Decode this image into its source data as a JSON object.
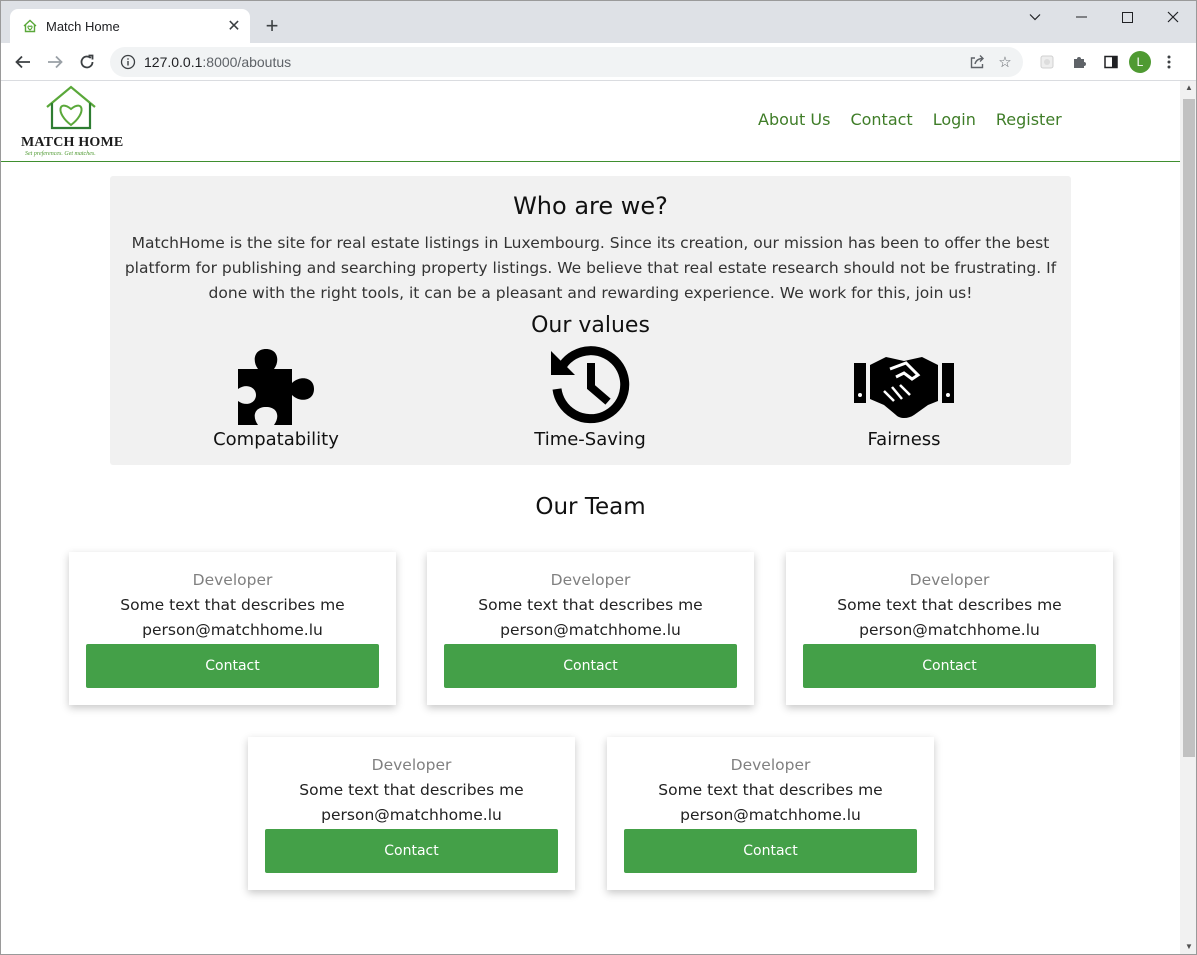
{
  "browser": {
    "tab_title": "Match Home",
    "url_host": "127.0.0.1",
    "url_rest": ":8000/aboutus",
    "profile_initial": "L"
  },
  "site": {
    "logo_text": "MATCH HOME",
    "logo_tagline": "Set preferences. Get matches.",
    "nav": [
      "About Us",
      "Contact",
      "Login",
      "Register"
    ],
    "brand_green": "#44a048"
  },
  "about": {
    "title": "Who are we?",
    "text": "MatchHome is the site for real estate listings in Luxembourg. Since its creation, our mission has been to offer the best platform for publishing and searching property listings. We believe that real estate research should not be frustrating. If done with the right tools, it can be a pleasant and rewarding experience. We work for this, join us!",
    "values_title": "Our values",
    "values": [
      {
        "label": "Compatability",
        "icon": "puzzle-icon"
      },
      {
        "label": "Time-Saving",
        "icon": "history-icon"
      },
      {
        "label": "Fairness",
        "icon": "handshake-icon"
      }
    ]
  },
  "team": {
    "title": "Our Team",
    "members": [
      {
        "role": "Developer",
        "desc": "Some text that describes me",
        "email": "person@matchhome.lu",
        "button": "Contact"
      },
      {
        "role": "Developer",
        "desc": "Some text that describes me",
        "email": "person@matchhome.lu",
        "button": "Contact"
      },
      {
        "role": "Developer",
        "desc": "Some text that describes me",
        "email": "person@matchhome.lu",
        "button": "Contact"
      },
      {
        "role": "Developer",
        "desc": "Some text that describes me",
        "email": "person@matchhome.lu",
        "button": "Contact"
      },
      {
        "role": "Developer",
        "desc": "Some text that describes me",
        "email": "person@matchhome.lu",
        "button": "Contact"
      }
    ]
  }
}
